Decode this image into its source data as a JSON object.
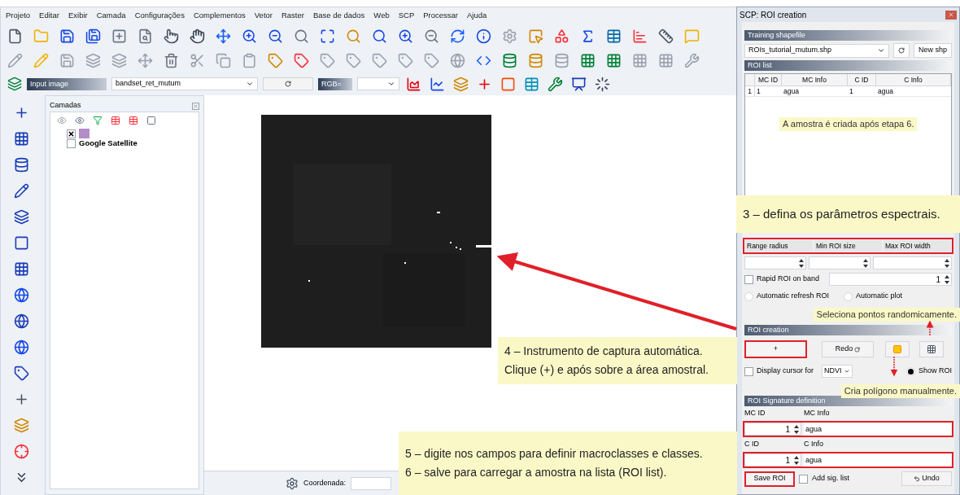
{
  "menu": [
    "Projeto",
    "Editar",
    "Exibir",
    "Camada",
    "Configurações",
    "Complementos",
    "Vetor",
    "Raster",
    "Base de dados",
    "Web",
    "SCP",
    "Processar",
    "Ajuda"
  ],
  "input_toolbar": {
    "input_label": "Input image",
    "input_value": "bandset_ret_mutum",
    "rgb_label": "RGB="
  },
  "layers_panel": {
    "title": "Camadas",
    "layers": [
      {
        "checked": true,
        "color": "#b48cc8"
      },
      {
        "name": "Google Satellite",
        "checked": false
      }
    ]
  },
  "status_bar": {
    "coordinate_label": "Coordenada:"
  },
  "scp": {
    "title": "SCP: ROI creation",
    "training_header": "Training shapefile",
    "shapefile": "ROIs_tutorial_mutum.shp",
    "new_button": "New shp",
    "roi_list_header": "ROI list",
    "table": {
      "columns": [
        "MC ID",
        "MC Info",
        "C ID",
        "C Info"
      ],
      "rows": [
        {
          "index": "1",
          "cells": [
            "1",
            "agua",
            "1",
            "agua"
          ]
        }
      ]
    },
    "param_labels": [
      "Range radius",
      "Min ROI size",
      "Max ROI width"
    ],
    "rapid": {
      "label": "Rapid ROI on band",
      "checked": false,
      "value": "1"
    },
    "radios": [
      {
        "label": "Automatic refresh ROI",
        "selected": false
      },
      {
        "label": "Automatic plot",
        "selected": false
      }
    ],
    "creation_header": "ROI creation",
    "plus_button": "+",
    "redo_button": "Redo",
    "display_cursor": {
      "label": "Display cursor for",
      "checked": false,
      "value": "NDVI"
    },
    "show_roi": {
      "label": "Show ROI",
      "selected": true
    },
    "signature_header": "ROI Signature definition",
    "mc_id_label": "MC ID",
    "mc_info_label": "MC Info",
    "mc_id": "1",
    "mc_info": "agua",
    "c_id_label": "C ID",
    "c_info_label": "C Info",
    "c_id": "1",
    "c_info": "agua",
    "save_button": "Save ROI",
    "add_sig": {
      "label": "Add sig. list",
      "checked": false
    },
    "undo_button": "Undo"
  },
  "notes": [
    {
      "kind": "small",
      "text": "A amostra é criada após etapa 6."
    },
    {
      "kind": "large",
      "text": "3 – defina os parâmetros espectrais."
    },
    {
      "kind": "small",
      "text": "Seleciona pontos randomicamente."
    },
    {
      "kind": "block",
      "lines": [
        "4 – Instrumento de captura automática.",
        "Clique (+) e após sobre a área amostral."
      ]
    },
    {
      "kind": "small",
      "text": "Cria polígono manualmente."
    },
    {
      "kind": "block",
      "lines": [
        "5 – digite nos campos para definir macroclasses e classes.",
        "6 – salve para carregar a amostra na lista (ROI list)."
      ]
    }
  ]
}
